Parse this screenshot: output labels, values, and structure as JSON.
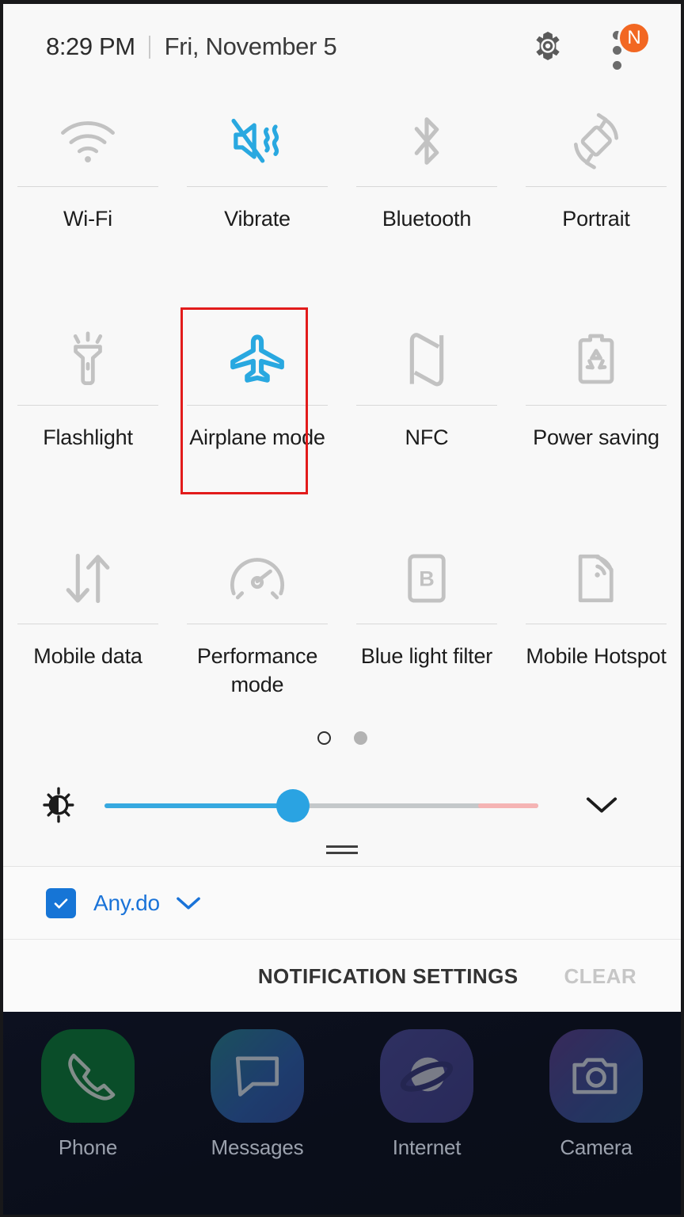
{
  "statusbar": {
    "time": "8:29 PM",
    "date": "Fri, November 5",
    "settings_icon": "gear-icon",
    "menu_icon": "kebab-menu-icon",
    "badge_letter": "N",
    "badge_color": "#f26722"
  },
  "quick_settings": {
    "tiles": [
      {
        "label": "Wi-Fi",
        "icon": "wifi-icon",
        "state": "off"
      },
      {
        "label": "Vibrate",
        "icon": "vibrate-icon",
        "state": "on"
      },
      {
        "label": "Bluetooth",
        "icon": "bluetooth-icon",
        "state": "off"
      },
      {
        "label": "Portrait",
        "icon": "screen-rotation-icon",
        "state": "off"
      },
      {
        "label": "Flashlight",
        "icon": "flashlight-icon",
        "state": "off"
      },
      {
        "label": "Airplane mode",
        "icon": "airplane-icon",
        "state": "on"
      },
      {
        "label": "NFC",
        "icon": "nfc-icon",
        "state": "off"
      },
      {
        "label": "Power saving",
        "icon": "battery-recycle-icon",
        "state": "off"
      },
      {
        "label": "Mobile data",
        "icon": "data-arrows-icon",
        "state": "off"
      },
      {
        "label": "Performance mode",
        "icon": "gauge-icon",
        "state": "off"
      },
      {
        "label": "Blue light filter",
        "icon": "blue-light-filter-icon",
        "state": "off"
      },
      {
        "label": "Mobile Hotspot",
        "icon": "hotspot-icon",
        "state": "off"
      }
    ],
    "active_color": "#29a8e0",
    "inactive_color": "#bdbdbd",
    "highlight_color": "#e21b1b",
    "highlighted_tile": "Airplane mode",
    "pages": {
      "count": 2,
      "current": 1
    }
  },
  "brightness": {
    "icon": "brightness-icon",
    "value_percent": 44,
    "fill_color": "#37a9e0",
    "expand_icon": "chevron-down-icon"
  },
  "drag_handle": "panel-drag-handle",
  "notifications": {
    "items": [
      {
        "app": "Any.do",
        "icon": "checkbox-check-icon",
        "expand_icon": "chevron-down-icon",
        "color": "#1a73d8"
      }
    ],
    "settings_label": "NOTIFICATION SETTINGS",
    "clear_label": "CLEAR"
  },
  "dock": {
    "apps": [
      {
        "label": "Phone",
        "icon": "phone-handset-icon",
        "color": "#0e7a36"
      },
      {
        "label": "Messages",
        "icon": "speech-bubble-icon",
        "color": "#2f5fa8"
      },
      {
        "label": "Internet",
        "icon": "planet-icon",
        "color": "#4b4a93"
      },
      {
        "label": "Camera",
        "icon": "camera-icon",
        "color": "#3c4f93"
      }
    ]
  }
}
